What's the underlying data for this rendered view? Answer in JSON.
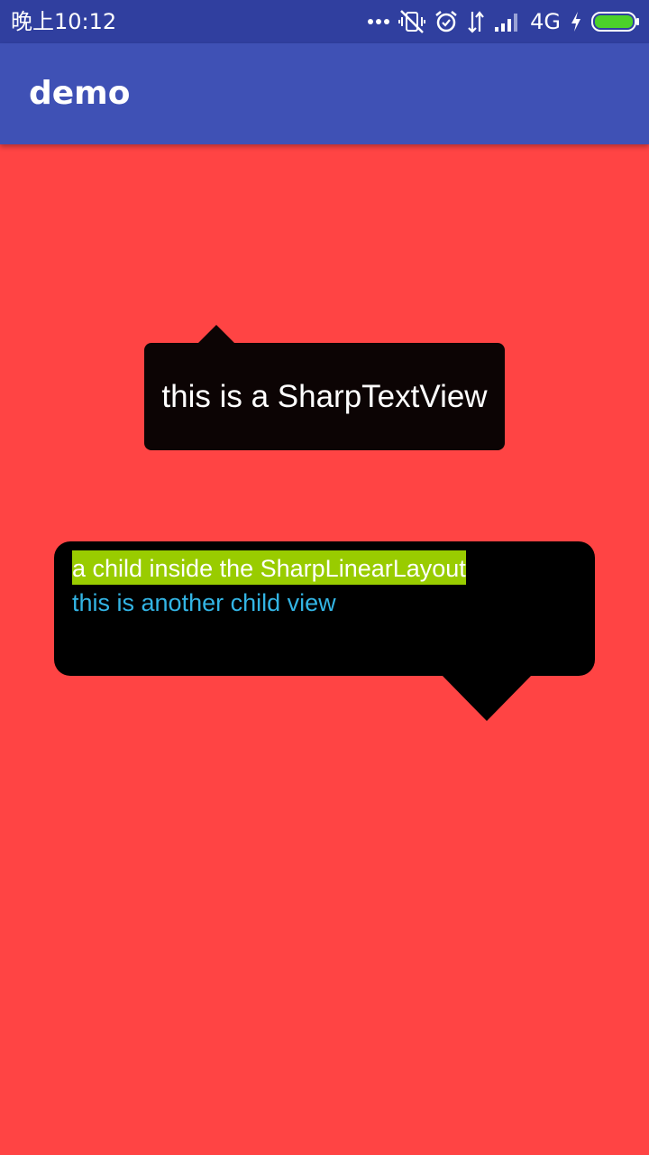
{
  "status_bar": {
    "time": "晚上10:12",
    "network": "4G",
    "icons": [
      "more-dots-icon",
      "vibrate-off-icon",
      "alarm-icon",
      "data-arrows-icon",
      "signal-icon",
      "charging-icon",
      "battery-icon"
    ]
  },
  "app_bar": {
    "title": "demo"
  },
  "sharp_text_view": {
    "text": "this is a SharpTextView"
  },
  "sharp_linear_layout": {
    "child_one": "a child inside the SharpLinearLayout",
    "child_two": "this is another child view"
  },
  "colors": {
    "status_bar": "#303F9F",
    "app_bar": "#3F51B5",
    "background": "#FF4444",
    "bubble": "#000000",
    "highlight": "#99CC00",
    "accent_text": "#33B5E5",
    "battery": "#4CD12A"
  }
}
